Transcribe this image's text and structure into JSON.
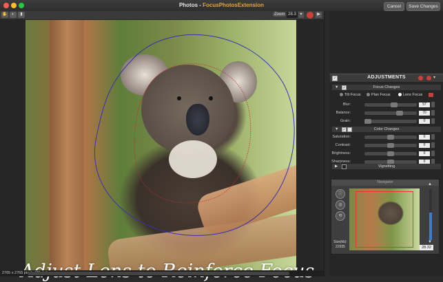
{
  "window": {
    "title": "Photos",
    "title_sep": " - ",
    "extension": "FocusPhotosExtension"
  },
  "header": {
    "cancel_label": "Cancel",
    "save_label": "Save Changes"
  },
  "toolbar": {
    "zoom_label": "Zoom",
    "zoom_value": "28.3"
  },
  "status": {
    "text": "2765 x 2765 pixels (72 dpi)"
  },
  "caption": "Adjust Lens to Reinforce Focus",
  "adjustments": {
    "title": "ADJUSTMENTS",
    "focus_changes": {
      "title": "Focus Changes",
      "modes": [
        "Tilt Focus",
        "Plan Focus",
        "Lens Focus"
      ],
      "selected_mode": "Lens Focus",
      "rows": [
        {
          "label": "Blur:",
          "value": "57",
          "fraction": 0.57
        },
        {
          "label": "Balance:",
          "value": "70",
          "fraction": 0.7
        },
        {
          "label": "Grain:",
          "value": "0",
          "fraction": 0.0
        }
      ]
    },
    "color_changes": {
      "title": "Color Changes",
      "rows": [
        {
          "label": "Saturation:",
          "value": "0",
          "fraction": 0.5
        },
        {
          "label": "Contrast:",
          "value": "0",
          "fraction": 0.5
        },
        {
          "label": "Brightness:",
          "value": "0",
          "fraction": 0.5
        },
        {
          "label": "Sharpness:",
          "value": "0",
          "fraction": 0.5
        }
      ]
    },
    "vignetting": {
      "title": "Vignetting"
    }
  },
  "navigator": {
    "title": "Navigator",
    "size_label": "Size(kb):",
    "size_value": "22935",
    "zoom_value": "28.32"
  },
  "colors": {
    "accent": "#e8a33c",
    "close": "#ff5f57",
    "minimize": "#febc2e",
    "maximize": "#28c840",
    "red_button": "#c9403a",
    "navigator_frame": "#e33333"
  }
}
